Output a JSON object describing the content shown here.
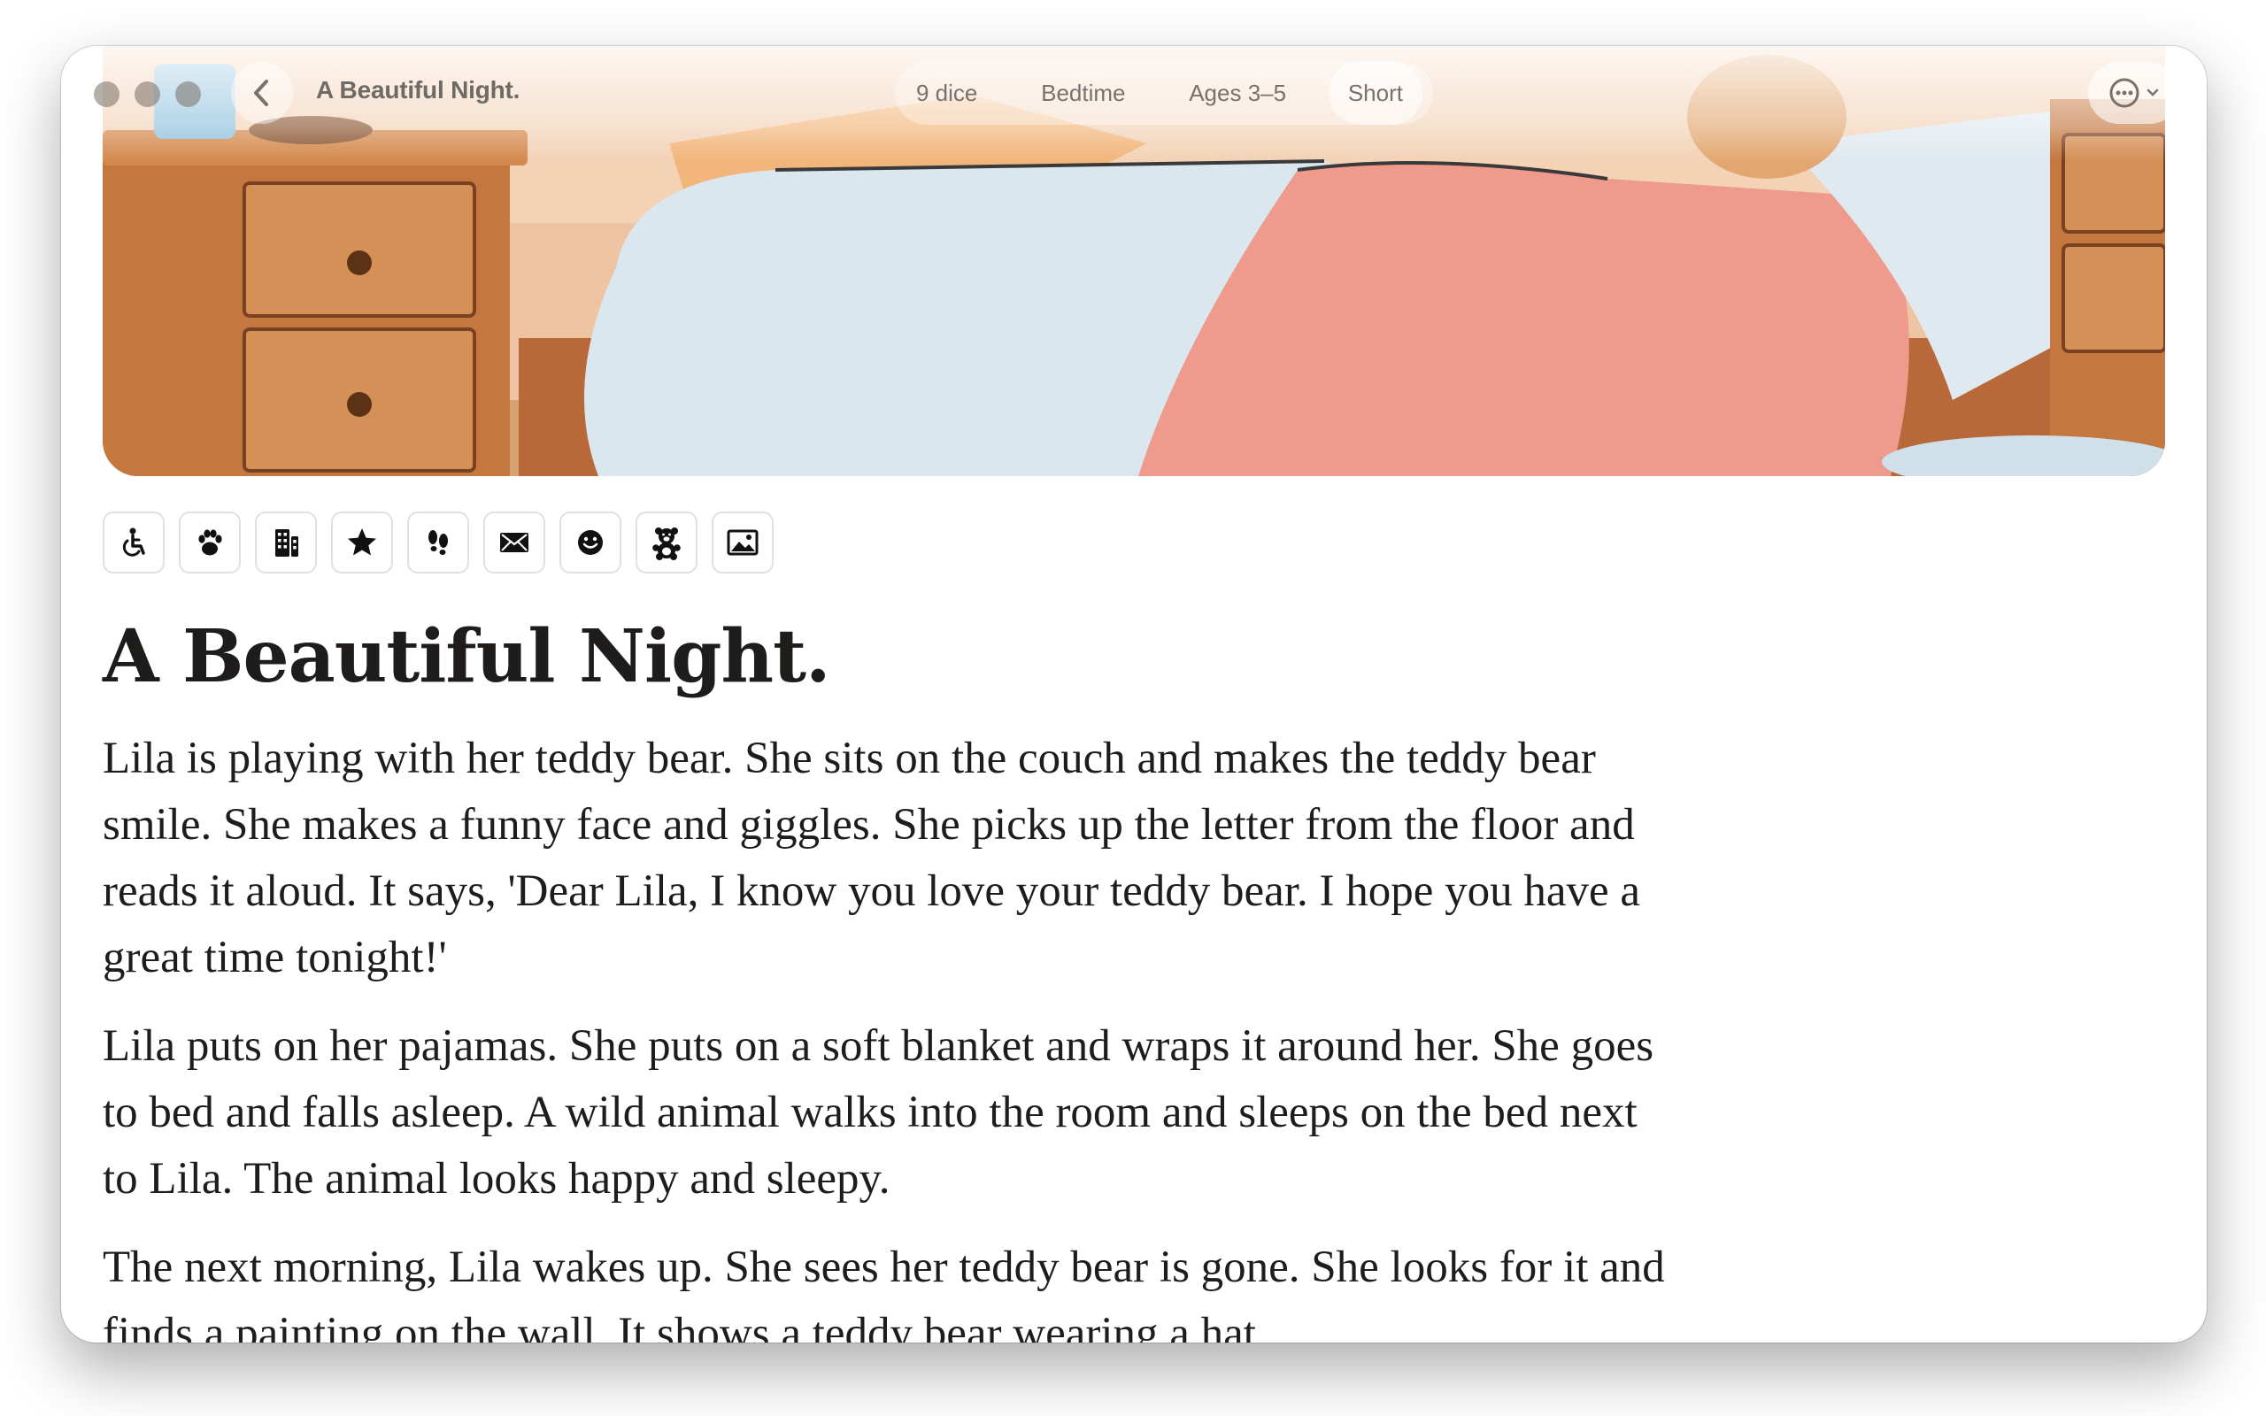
{
  "window": {
    "title": "A Beautiful Night.",
    "tags": [
      "9 dice",
      "Bedtime",
      "Ages 3–5",
      "Short"
    ]
  },
  "toolbar": {
    "icons": [
      "wheelchair-icon",
      "paw-icon",
      "building-icon",
      "star-icon",
      "footprints-icon",
      "envelope-icon",
      "smiley-icon",
      "teddy-bear-icon",
      "picture-icon"
    ]
  },
  "story": {
    "title": "A Beautiful Night.",
    "paragraphs": [
      "Lila is playing with her teddy bear. She sits on the couch and makes the teddy bear smile. She makes a funny face and giggles. She picks up the letter from the floor and reads it aloud. It says, 'Dear Lila, I know you love your teddy bear. I hope you have a great time tonight!'",
      "Lila puts on her pajamas. She puts on a soft blanket and wraps it around her. She goes to bed and falls asleep. A wild animal walks into the room and sleeps on the bed next to Lila. The animal looks happy and sleepy.",
      "The next morning, Lila wakes up. She sees her teddy bear is gone. She looks for it and finds a painting on the wall. It shows a teddy bear wearing a hat."
    ]
  },
  "colors": {
    "blanket_pink": "#ee9a8c",
    "sheet_blue": "#dfe9ef",
    "wood": "#c77f49"
  }
}
